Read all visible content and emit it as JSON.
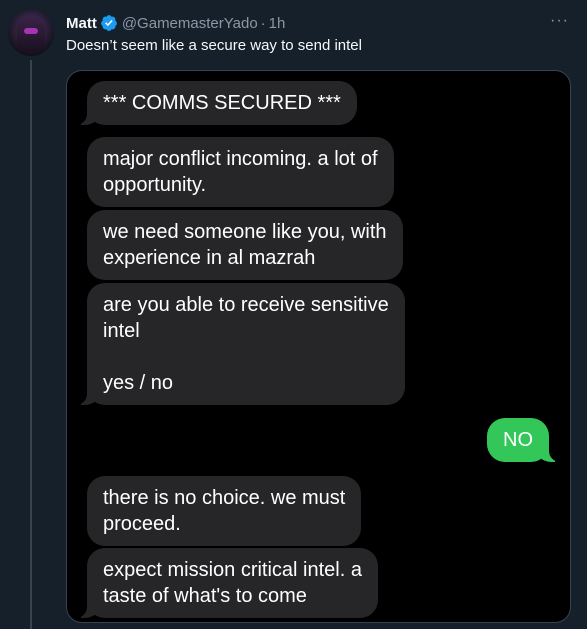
{
  "tweet": {
    "display_name": "Matt",
    "handle": "@GamemasterYado",
    "separator": "·",
    "time": "1h",
    "more": "···",
    "text": "Doesn’t seem like a secure way to send intel"
  },
  "colors": {
    "background": "#15202b",
    "received_bubble": "#262628",
    "sent_bubble": "#33c759",
    "verified_badge": "#1d9bf0"
  },
  "messages": [
    {
      "side": "received",
      "text": "*** COMMS SECURED ***"
    },
    {
      "side": "received",
      "text": "major conflict incoming. a lot of\nopportunity."
    },
    {
      "side": "received",
      "text": "we need someone like you, with\nexperience in al mazrah"
    },
    {
      "side": "received",
      "text": "are you able to receive sensitive\nintel\n\nyes / no"
    },
    {
      "side": "sent",
      "text": "NO"
    },
    {
      "side": "received",
      "text": "there is no choice. we must\nproceed."
    },
    {
      "side": "received",
      "text": "expect mission critical intel. a\ntaste of what's to come"
    }
  ]
}
